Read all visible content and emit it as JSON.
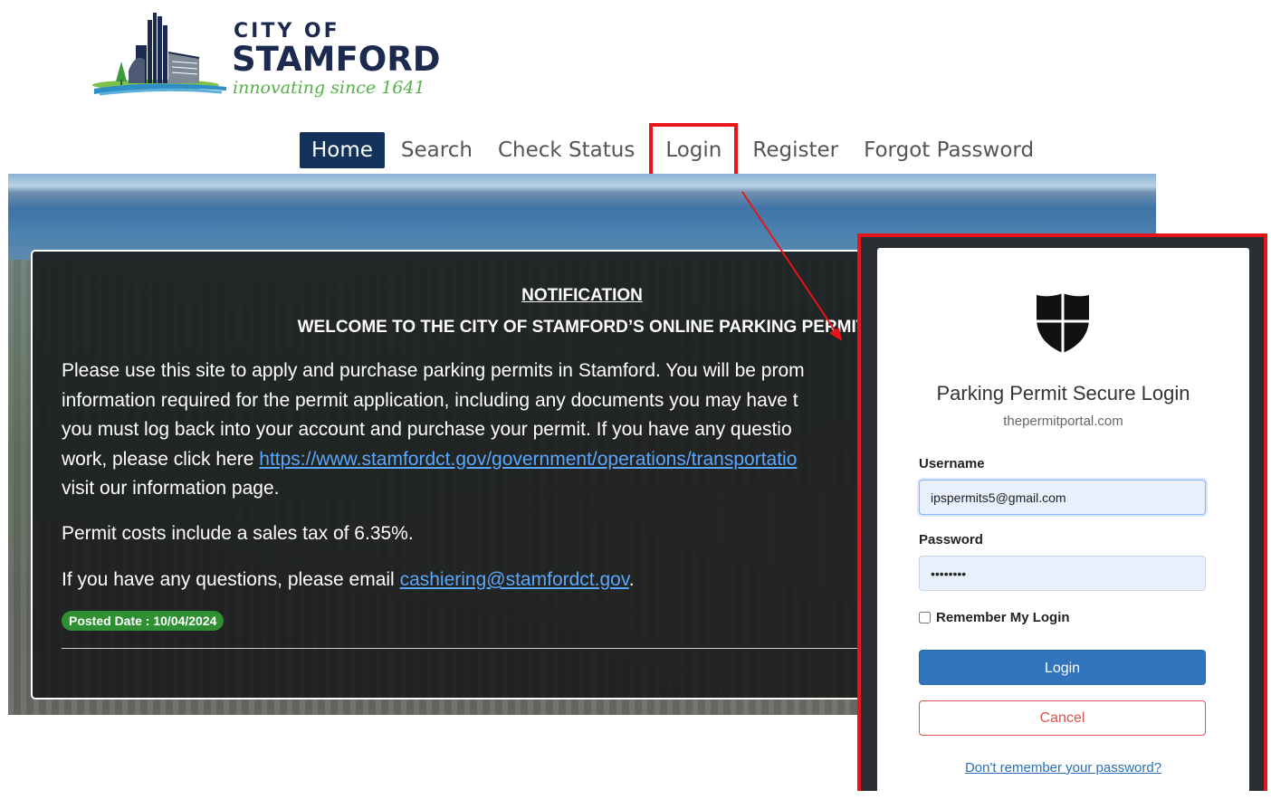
{
  "logo": {
    "line1": "CITY OF",
    "line2": "STAMFORD",
    "tagline": "innovating since 1641"
  },
  "nav": {
    "items": [
      {
        "label": "Home"
      },
      {
        "label": "Search"
      },
      {
        "label": "Check Status"
      },
      {
        "label": "Login"
      },
      {
        "label": "Register"
      },
      {
        "label": "Forgot Password"
      }
    ],
    "active_color": "#13335c",
    "highlight_color": "#e8141b"
  },
  "notice": {
    "title": "NOTIFICATION",
    "subtitle": "WELCOME TO THE CITY OF STAMFORD’S ONLINE PARKING PERMIT",
    "para_lines": [
      "Please use this site to apply and purchase parking permits in Stamford. You will be prom",
      "information required for the permit application, including any documents you may have t",
      "you must log back into your account and purchase your permit. If you have any questio"
    ],
    "para_line4_prefix": "work, please click here ",
    "para_link": "https://www.stamfordct.gov/government/operations/transportatio",
    "para_line5": "visit our information page.",
    "tax_text": "Permit costs include a sales tax of 6.35%.",
    "email_prefix": "If you have any questions, please email ",
    "email_link": "cashiering@stamfordct.gov",
    "email_suffix": ".",
    "posted_date": "Posted Date : 10/04/2024"
  },
  "login": {
    "title": "Parking Permit Secure Login",
    "site": "thepermitportal.com",
    "username_label": "Username",
    "username_value": "ipspermits5@gmail.com",
    "password_label": "Password",
    "password_value": "dummypwd",
    "remember_label": "Remember My Login",
    "login_button": "Login",
    "cancel_button": "Cancel",
    "forgot_link": "Don't remember your password?"
  }
}
